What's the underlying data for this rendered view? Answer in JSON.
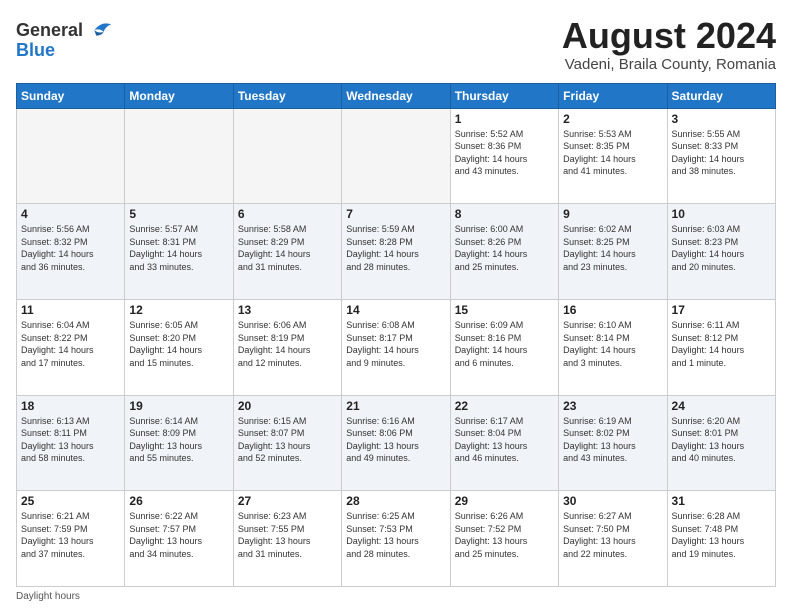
{
  "header": {
    "logo_line1": "General",
    "logo_line2": "Blue",
    "title": "August 2024",
    "subtitle": "Vadeni, Braila County, Romania"
  },
  "days_of_week": [
    "Sunday",
    "Monday",
    "Tuesday",
    "Wednesday",
    "Thursday",
    "Friday",
    "Saturday"
  ],
  "footer": {
    "daylight_label": "Daylight hours"
  },
  "weeks": [
    [
      {
        "day": "",
        "info": ""
      },
      {
        "day": "",
        "info": ""
      },
      {
        "day": "",
        "info": ""
      },
      {
        "day": "",
        "info": ""
      },
      {
        "day": "1",
        "info": "Sunrise: 5:52 AM\nSunset: 8:36 PM\nDaylight: 14 hours\nand 43 minutes."
      },
      {
        "day": "2",
        "info": "Sunrise: 5:53 AM\nSunset: 8:35 PM\nDaylight: 14 hours\nand 41 minutes."
      },
      {
        "day": "3",
        "info": "Sunrise: 5:55 AM\nSunset: 8:33 PM\nDaylight: 14 hours\nand 38 minutes."
      }
    ],
    [
      {
        "day": "4",
        "info": "Sunrise: 5:56 AM\nSunset: 8:32 PM\nDaylight: 14 hours\nand 36 minutes."
      },
      {
        "day": "5",
        "info": "Sunrise: 5:57 AM\nSunset: 8:31 PM\nDaylight: 14 hours\nand 33 minutes."
      },
      {
        "day": "6",
        "info": "Sunrise: 5:58 AM\nSunset: 8:29 PM\nDaylight: 14 hours\nand 31 minutes."
      },
      {
        "day": "7",
        "info": "Sunrise: 5:59 AM\nSunset: 8:28 PM\nDaylight: 14 hours\nand 28 minutes."
      },
      {
        "day": "8",
        "info": "Sunrise: 6:00 AM\nSunset: 8:26 PM\nDaylight: 14 hours\nand 25 minutes."
      },
      {
        "day": "9",
        "info": "Sunrise: 6:02 AM\nSunset: 8:25 PM\nDaylight: 14 hours\nand 23 minutes."
      },
      {
        "day": "10",
        "info": "Sunrise: 6:03 AM\nSunset: 8:23 PM\nDaylight: 14 hours\nand 20 minutes."
      }
    ],
    [
      {
        "day": "11",
        "info": "Sunrise: 6:04 AM\nSunset: 8:22 PM\nDaylight: 14 hours\nand 17 minutes."
      },
      {
        "day": "12",
        "info": "Sunrise: 6:05 AM\nSunset: 8:20 PM\nDaylight: 14 hours\nand 15 minutes."
      },
      {
        "day": "13",
        "info": "Sunrise: 6:06 AM\nSunset: 8:19 PM\nDaylight: 14 hours\nand 12 minutes."
      },
      {
        "day": "14",
        "info": "Sunrise: 6:08 AM\nSunset: 8:17 PM\nDaylight: 14 hours\nand 9 minutes."
      },
      {
        "day": "15",
        "info": "Sunrise: 6:09 AM\nSunset: 8:16 PM\nDaylight: 14 hours\nand 6 minutes."
      },
      {
        "day": "16",
        "info": "Sunrise: 6:10 AM\nSunset: 8:14 PM\nDaylight: 14 hours\nand 3 minutes."
      },
      {
        "day": "17",
        "info": "Sunrise: 6:11 AM\nSunset: 8:12 PM\nDaylight: 14 hours\nand 1 minute."
      }
    ],
    [
      {
        "day": "18",
        "info": "Sunrise: 6:13 AM\nSunset: 8:11 PM\nDaylight: 13 hours\nand 58 minutes."
      },
      {
        "day": "19",
        "info": "Sunrise: 6:14 AM\nSunset: 8:09 PM\nDaylight: 13 hours\nand 55 minutes."
      },
      {
        "day": "20",
        "info": "Sunrise: 6:15 AM\nSunset: 8:07 PM\nDaylight: 13 hours\nand 52 minutes."
      },
      {
        "day": "21",
        "info": "Sunrise: 6:16 AM\nSunset: 8:06 PM\nDaylight: 13 hours\nand 49 minutes."
      },
      {
        "day": "22",
        "info": "Sunrise: 6:17 AM\nSunset: 8:04 PM\nDaylight: 13 hours\nand 46 minutes."
      },
      {
        "day": "23",
        "info": "Sunrise: 6:19 AM\nSunset: 8:02 PM\nDaylight: 13 hours\nand 43 minutes."
      },
      {
        "day": "24",
        "info": "Sunrise: 6:20 AM\nSunset: 8:01 PM\nDaylight: 13 hours\nand 40 minutes."
      }
    ],
    [
      {
        "day": "25",
        "info": "Sunrise: 6:21 AM\nSunset: 7:59 PM\nDaylight: 13 hours\nand 37 minutes."
      },
      {
        "day": "26",
        "info": "Sunrise: 6:22 AM\nSunset: 7:57 PM\nDaylight: 13 hours\nand 34 minutes."
      },
      {
        "day": "27",
        "info": "Sunrise: 6:23 AM\nSunset: 7:55 PM\nDaylight: 13 hours\nand 31 minutes."
      },
      {
        "day": "28",
        "info": "Sunrise: 6:25 AM\nSunset: 7:53 PM\nDaylight: 13 hours\nand 28 minutes."
      },
      {
        "day": "29",
        "info": "Sunrise: 6:26 AM\nSunset: 7:52 PM\nDaylight: 13 hours\nand 25 minutes."
      },
      {
        "day": "30",
        "info": "Sunrise: 6:27 AM\nSunset: 7:50 PM\nDaylight: 13 hours\nand 22 minutes."
      },
      {
        "day": "31",
        "info": "Sunrise: 6:28 AM\nSunset: 7:48 PM\nDaylight: 13 hours\nand 19 minutes."
      }
    ]
  ]
}
